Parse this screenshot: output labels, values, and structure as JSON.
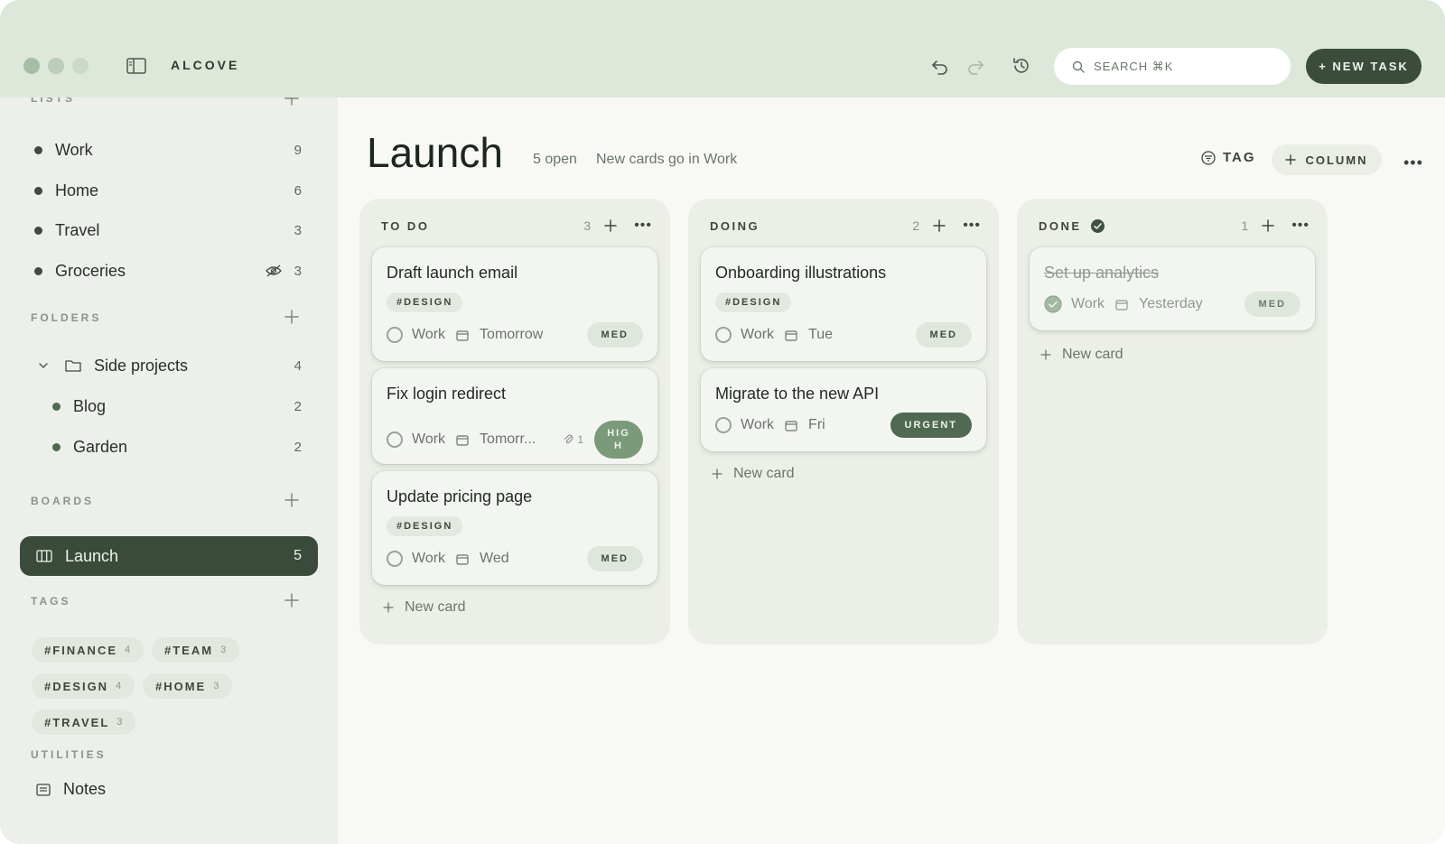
{
  "app": {
    "name": "ALCOVE"
  },
  "toolbar": {
    "search_placeholder": "SEARCH ⌘K",
    "new_task_label": "+ NEW TASK"
  },
  "sidebar": {
    "lists_heading": "LISTS",
    "lists": [
      {
        "label": "Work",
        "count": "9"
      },
      {
        "label": "Home",
        "count": "6"
      },
      {
        "label": "Travel",
        "count": "3"
      },
      {
        "label": "Groceries",
        "count": "3",
        "hidden": true
      }
    ],
    "folders_heading": "FOLDERS",
    "folder": {
      "label": "Side projects",
      "count": "4"
    },
    "folder_children": [
      {
        "label": "Blog",
        "count": "2"
      },
      {
        "label": "Garden",
        "count": "2"
      }
    ],
    "boards_heading": "BOARDS",
    "active_board": {
      "label": "Launch",
      "count": "5"
    },
    "tags_heading": "TAGS",
    "tags": [
      {
        "label": "#FINANCE",
        "count": "4"
      },
      {
        "label": "#TEAM",
        "count": "3"
      },
      {
        "label": "#DESIGN",
        "count": "4"
      },
      {
        "label": "#HOME",
        "count": "3"
      },
      {
        "label": "#TRAVEL",
        "count": "3"
      }
    ],
    "utilities_heading": "UTILITIES",
    "notes_label": "Notes"
  },
  "board": {
    "title": "Launch",
    "open_count": "5 open",
    "new_cards_note": "New cards go in Work",
    "tag_filter_label": "TAG",
    "add_column_label": "COLUMN",
    "new_card_label": "New card",
    "columns": [
      {
        "title": "TO DO",
        "count": "3",
        "cards": [
          {
            "title": "Draft launch email",
            "tag": "#DESIGN",
            "list": "Work",
            "date": "Tomorrow",
            "priority": "MED"
          },
          {
            "title": "Fix login redirect",
            "list": "Work",
            "date": "Tomorr...",
            "attachments": "1",
            "priority": "HIGH"
          },
          {
            "title": "Update pricing page",
            "tag": "#DESIGN",
            "list": "Work",
            "date": "Wed",
            "priority": "MED"
          }
        ]
      },
      {
        "title": "DOING",
        "count": "2",
        "cards": [
          {
            "title": "Onboarding illustrations",
            "tag": "#DESIGN",
            "list": "Work",
            "date": "Tue",
            "priority": "MED"
          },
          {
            "title": "Migrate to the new API",
            "list": "Work",
            "date": "Fri",
            "priority": "URGENT"
          }
        ]
      },
      {
        "title": "DONE",
        "count": "1",
        "cards": [
          {
            "title": "Set up analytics",
            "list": "Work",
            "date": "Yesterday",
            "priority": "MED",
            "done": true
          }
        ]
      }
    ]
  },
  "colors": {
    "accent_dark": "#3a4b3b",
    "titlebar": "#dde8db",
    "sidebar": "#edf0ea",
    "priority_urgent": "#4f6a50",
    "priority_high": "#7a9a79"
  }
}
